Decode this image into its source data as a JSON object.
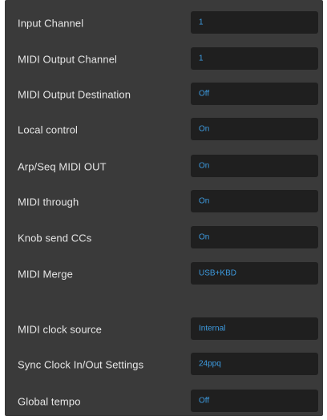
{
  "settings": [
    {
      "label": "Input Channel",
      "value": "1"
    },
    {
      "label": "MIDI Output Channel",
      "value": "1"
    },
    {
      "label": "MIDI Output Destination",
      "value": "Off"
    },
    {
      "label": "Local control",
      "value": "On"
    },
    {
      "label": "Arp/Seq MIDI OUT",
      "value": "On"
    },
    {
      "label": "MIDI through",
      "value": "On"
    },
    {
      "label": "Knob send CCs",
      "value": "On"
    },
    {
      "label": "MIDI Merge",
      "value": "USB+KBD"
    },
    {
      "label": "MIDI clock source",
      "value": "Internal"
    },
    {
      "label": "Sync Clock In/Out Settings",
      "value": "24ppq"
    },
    {
      "label": "Global tempo",
      "value": "Off"
    }
  ],
  "colors": {
    "panel": "#3a3a3a",
    "field": "#1f1f1f",
    "label_text": "#e6e6e6",
    "value_text": "#3d9be0"
  }
}
